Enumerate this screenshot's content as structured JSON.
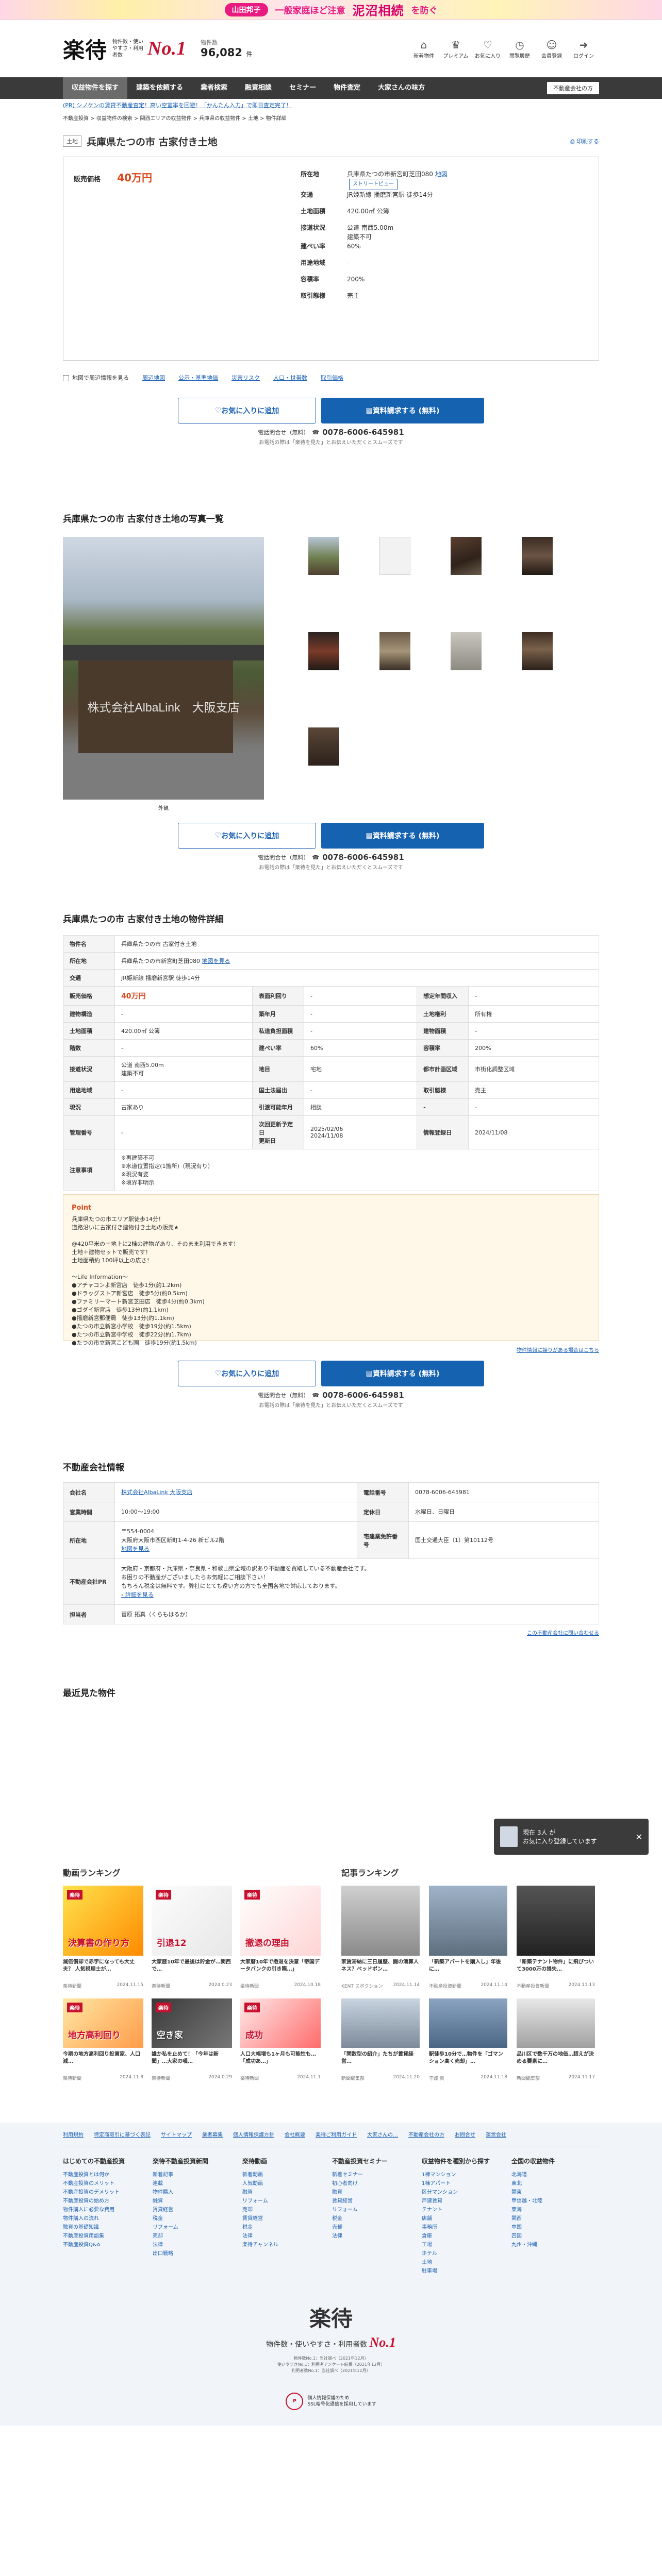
{
  "banner": {
    "person": "山田邦子",
    "text1": "一般家庭ほど注意",
    "text2": "泥沼相続",
    "text3": "を防ぐ"
  },
  "header": {
    "logo": "楽待",
    "tagline": "物件数・使いやすさ・利用者数",
    "no1": "No.1",
    "count_label": "物件数",
    "count_value": "96,082",
    "count_unit": "件",
    "icons": [
      {
        "name": "新着物件",
        "icon": "house-icon",
        "glyph": "⌂"
      },
      {
        "name": "プレミアム",
        "icon": "crown-icon",
        "glyph": "♛"
      },
      {
        "name": "お気に入り",
        "icon": "heart-icon",
        "glyph": "♡"
      },
      {
        "name": "閲覧履歴",
        "icon": "clock-icon",
        "glyph": "◷"
      },
      {
        "name": "会員登録",
        "icon": "user-plus-icon",
        "glyph": "☺"
      },
      {
        "name": "ログイン",
        "icon": "login-icon",
        "glyph": "➜"
      }
    ]
  },
  "nav": {
    "items": [
      "収益物件を探す",
      "建築を依頼する",
      "業者検索",
      "融資相談",
      "セミナー",
      "物件査定",
      "大家さんの味方"
    ],
    "active": 0,
    "button": "不動産会社の方"
  },
  "notice": "(PR) シノケンの賃貸不動産査定！高い空室率を回避！「かんたん入力」で即日査定完了！",
  "breadcrumbs": "不動産投資 > 収益物件の検索 > 関西エリアの収益物件 > 兵庫県の収益物件 > 土地 > 物件詳細",
  "title": {
    "tag": "土地",
    "name": "兵庫県たつの市 古家付き土地",
    "print": "印刷する"
  },
  "summary": {
    "price_label": "販売価格",
    "price": "40万円",
    "rows": [
      {
        "k": "所在地",
        "v": "兵庫県たつの市新宮町芝田080",
        "link": "地図",
        "chip": "ストリートビュー"
      },
      {
        "k": "交通",
        "v": "JR姫新線 播磨新宮駅 徒歩14分"
      },
      {
        "k": "土地面積",
        "v": "420.00㎡ 公簿"
      },
      {
        "k": "接道状況",
        "v": "公道 南西5.00m\n建築不可"
      },
      {
        "k": "建ぺい率",
        "v": "60%"
      },
      {
        "k": "用途地域",
        "v": "-"
      },
      {
        "k": "容積率",
        "v": "200%"
      },
      {
        "k": "取引態様",
        "v": "売主"
      }
    ]
  },
  "map_options": {
    "label": "地図で周辺情報を見る",
    "items": [
      "周辺地図",
      "公示・基準地価",
      "災害リスク",
      "人口・世帯数",
      "取引価格"
    ]
  },
  "cta": {
    "fav": "お気に入りに追加",
    "request": "資料請求する (無料)",
    "tel_label": "電話問合せ（無料）",
    "tel": "0078-6006-645981",
    "tel_note": "※ 通話料無料・発信者番号を通知してください",
    "agree": "お電話の際は「楽待を見た」とお伝えいただくとスムーズです"
  },
  "photos": {
    "title": "兵庫県たつの市 古家付き土地の写真一覧",
    "watermark": "株式会社AlbaLink　大阪支店",
    "caption": "外観"
  },
  "details": {
    "title": "兵庫県たつの市 古家付き土地の物件詳細",
    "rows": [
      [
        {
          "k": "物件名",
          "v": "兵庫県たつの市 古家付き土地",
          "span": 5
        }
      ],
      [
        {
          "k": "所在地",
          "v": "兵庫県たつの市新宮町芝田080",
          "link": "地図を見る",
          "span": 5
        }
      ],
      [
        {
          "k": "交通",
          "v": "JR姫新線 播磨新宮駅 徒歩14分",
          "span": 5
        }
      ],
      [
        {
          "k": "販売価格",
          "v": "40万円",
          "price": true
        },
        {
          "k": "表面利回り",
          "v": "-"
        },
        {
          "k": "想定年間収入",
          "v": "-"
        }
      ],
      [
        {
          "k": "建物構造",
          "v": "-"
        },
        {
          "k": "築年月",
          "v": "-"
        },
        {
          "k": "土地権利",
          "v": "所有権"
        }
      ],
      [
        {
          "k": "土地面積",
          "v": "420.00㎡ 公簿"
        },
        {
          "k": "私道負担面積",
          "v": "-"
        },
        {
          "k": "建物面積",
          "v": "-"
        }
      ],
      [
        {
          "k": "階数",
          "v": "-"
        },
        {
          "k": "建ぺい率",
          "v": "60%"
        },
        {
          "k": "容積率",
          "v": "200%"
        }
      ],
      [
        {
          "k": "接道状況",
          "v": "公道 南西5.00m\n建築不可"
        },
        {
          "k": "地目",
          "v": "宅地"
        },
        {
          "k": "都市計画区域",
          "v": "市街化調整区域"
        }
      ],
      [
        {
          "k": "用途地域",
          "v": "-"
        },
        {
          "k": "国土法届出",
          "v": "-"
        },
        {
          "k": "取引態様",
          "v": "売主"
        }
      ],
      [
        {
          "k": "現況",
          "v": "古家あり"
        },
        {
          "k": "引渡可能年月",
          "v": "相談"
        },
        {
          "k": "-",
          "v": "-"
        }
      ],
      [
        {
          "k": "管理番号",
          "v": "-"
        },
        {
          "k": "次回更新予定日\n更新日",
          "v": "2025/02/06\n2024/11/08"
        },
        {
          "k": "情報登録日",
          "v": "2024/11/08"
        }
      ],
      [
        {
          "k": "注意事項",
          "v": "※再建築不可\n※水道位置指定(1箇所)（現況有り）\n※現況有姿\n※境界非明示",
          "span": 5
        }
      ]
    ],
    "point_title": "Point",
    "point_body": "兵庫県たつの市エリア駅徒歩14分！\n道路沿いに古家付き建物付き土地の販売★\n\n@420平米の土地上に2棟の建物があり、そのまま利用できます！\n土地＋建物セットで販売です！\n土地面積約 100坪以上の広さ！\n\n～Life Information～\n●アチャコンよ新宮店　徒歩1分(約1.2km)\n●ドラッグストア新宮店　徒歩5分(約0.5km)\n●ファミリーマート新宮芝田店　徒歩4分(約0.3km)\n●ゴダイ新宮店　徒歩13分(約1.1km)\n●播磨新宮郵便局　徒歩13分(約1.1km)\n●たつの市立新宮小学校　徒歩19分(約1.5km)\n●たつの市立新宮中学校　徒歩22分(約1.7km)\n●たつの市立新宮こども園　徒歩19分(約1.5km)",
    "report": "物件情報に誤りがある場合はこちら"
  },
  "company": {
    "title": "不動産会社情報",
    "rows": [
      [
        {
          "k": "会社名",
          "v": "株式会社AlbaLink 大阪支店",
          "link": true
        },
        {
          "k": "電話番号",
          "v": "0078-6006-645981"
        }
      ],
      [
        {
          "k": "営業時間",
          "v": "10:00～19:00"
        },
        {
          "k": "定休日",
          "v": "水曜日、日曜日"
        }
      ],
      [
        {
          "k": "所在地",
          "v": "〒554-0004\n大阪府大阪市西区新町1-4-26 新ビル2階",
          "link2": "地図を見る"
        },
        {
          "k": "宅建業免許番号",
          "v": "国土交通大臣（1）第10112号"
        }
      ],
      [
        {
          "k": "不動産会社PR",
          "v": "大阪府・京都府・兵庫県・奈良県・和歌山県全域の訳あり不動産を買取している不動産会社です。\nお困りの不動産がございましたらお気軽にご相談下さい！\nもちろん税金は無料です。弊社にとても遠い方の方でも全国各地で対応しております。",
          "link3": "詳細を見る",
          "span": 3
        }
      ],
      [
        {
          "k": "担当者",
          "v": "菅原 拓真（くらもはるか）",
          "span": 3
        }
      ]
    ],
    "inquiry": "この不動産会社に問い合わせる"
  },
  "toast": {
    "line1": "現在 3人 が",
    "line2": "お気に入り登録しています"
  },
  "recent": {
    "title": "最近見た物件"
  },
  "video_ranking": {
    "title": "動画ランキング",
    "items": [
      {
        "cap": "減価償却で赤字になっても大丈夫？ 人気税理士が…",
        "ch": "楽待新聞",
        "date": "2024.11.15",
        "badge": "楽待",
        "img": "決算書の作り方"
      },
      {
        "cap": "大家歴10年で最後は貯金が…関西で…",
        "ch": "楽待新聞",
        "date": "2024.0.23",
        "badge": "楽待",
        "img": "引退12"
      },
      {
        "cap": "大家暦10年で撤退を決意「帝国データバンクの引き際…」",
        "ch": "楽待新聞",
        "date": "2024.10.18",
        "badge": "楽待",
        "img": "撤退の理由"
      },
      {
        "cap": "今期の地方高利回り投資家、人口減…",
        "ch": "楽待新聞",
        "date": "2024.11.8",
        "badge": "楽待",
        "img": "地方高利回り"
      },
      {
        "cap": "誰か私を止めて！「今年は新聞」…大家の嘆…",
        "ch": "楽待新聞",
        "date": "2024.0.29",
        "badge": "楽待",
        "img": "空き家"
      },
      {
        "cap": "人口大幅増も1ヶ月も可能性も…「成功あ…」",
        "ch": "楽待新聞",
        "date": "2024.11.1",
        "badge": "楽待",
        "img": "成功"
      }
    ]
  },
  "article_ranking": {
    "title": "記事ランキング",
    "items": [
      {
        "cap": "家賃滞納に三日履歴、闘の清算人ネス？ベッドポン…",
        "author": "KENT スボクション",
        "date": "2024.11.14"
      },
      {
        "cap": "「新築アパートを購入し」年後に…",
        "author": "不動産投資新聞",
        "date": "2024.11.14"
      },
      {
        "cap": "「新築テナント物件」に飛びついて3000万の損失…",
        "author": "不動産投資新聞",
        "date": "2024.11.13"
      },
      {
        "cap": "「閑散型の紹介」たちが賃貸経営…",
        "author": "新聞編集部",
        "date": "2024.11.20"
      },
      {
        "cap": "駅徒歩10分で…物件を「ゴマンション高く売却」…",
        "author": "守護 眞",
        "date": "2024.11.18"
      },
      {
        "cap": "品川区で数千万の地価…超えが決める要素に…",
        "author": "新聞編集部",
        "date": "2024.11.17"
      }
    ]
  },
  "footer": {
    "links": [
      "利用規約",
      "特定商取引に基づく表記",
      "サイトマップ",
      "業者募集",
      "個人情報保護方針",
      "会社概要",
      "楽待ご利用ガイド",
      "大家さんの…",
      "不動産会社の方",
      "お問合せ",
      "運営会社"
    ],
    "cols": [
      {
        "h": "はじめての不動産投資",
        "items": [
          "不動産投資とは何か",
          "不動産投資のメリット",
          "不動産投資のデメリット",
          "不動産投資の始め方",
          "物件購入に必要な費用",
          "物件購入の流れ",
          "融資の基礎知識",
          "不動産投資用語集",
          "不動産投資Q&A"
        ]
      },
      {
        "h": "楽待不動産投資新聞",
        "items": [
          "新着記事",
          "連載",
          "物件購入",
          "融資",
          "賃貸経営",
          "税金",
          "リフォーム",
          "売却",
          "法律",
          "出口戦略"
        ]
      },
      {
        "h": "楽待動画",
        "items": [
          "新着動画",
          "人気動画",
          "融資",
          "リフォーム",
          "売却",
          "賃貸経営",
          "税金",
          "法律",
          "楽待チャンネル"
        ]
      },
      {
        "h": "不動産投資セミナー",
        "items": [
          "新着セミナー",
          "初心者向け",
          "融資",
          "賃貸経営",
          "リフォーム",
          "税金",
          "売却",
          "法律"
        ]
      },
      {
        "h": "収益物件を種別から探す",
        "items": [
          "1棟マンション",
          "1棟アパート",
          "区分マンション",
          "戸建賃貸",
          "テナント",
          "店舗",
          "事務所",
          "倉庫",
          "工場",
          "ホテル",
          "土地",
          "駐車場"
        ]
      },
      {
        "h": "全国の収益物件",
        "items": [
          "北海道",
          "東北",
          "関東",
          "甲信越・北陸",
          "東海",
          "関西",
          "中国",
          "四国",
          "九州・沖縄"
        ]
      }
    ],
    "logo": "楽待",
    "tag": "物件数・使いやすさ・利用者数",
    "no1": "No.1",
    "note": "物件数No.1：当社調べ（2021年12月）\n使いやすさNo.1：利用者アンケート結果（2021年12月）\n利用者数No.1：当社調べ（2021年12月）",
    "privacy_mark": "P",
    "privacy_text": "個人情報保護のため\nSSL暗号化通信を採用しています"
  }
}
